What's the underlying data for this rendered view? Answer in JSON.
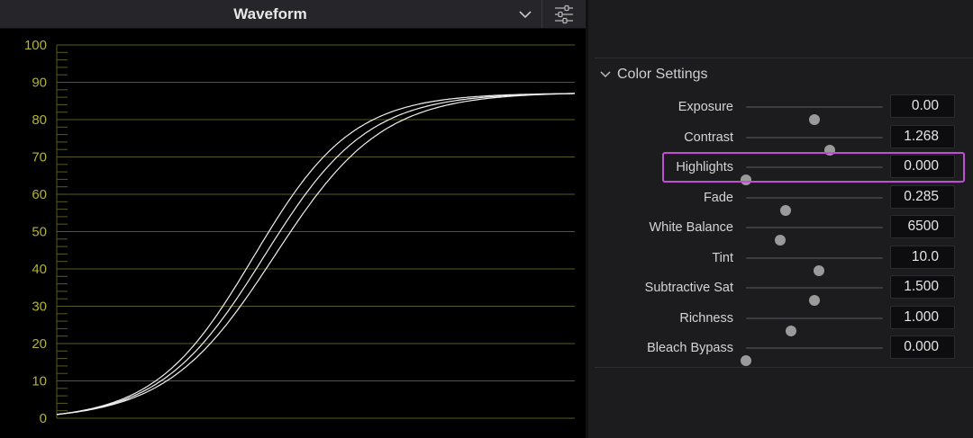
{
  "scope": {
    "title": "Waveform",
    "dropdown_icon": "chevron-down-icon",
    "settings_icon": "sliders-icon",
    "y_ticks": [
      "0",
      "10",
      "20",
      "30",
      "40",
      "50",
      "60",
      "70",
      "80",
      "90",
      "100"
    ],
    "colors": {
      "tick_label": "#b2b234",
      "gridline": "#5a5a20",
      "trace": "#f0f0f0"
    }
  },
  "panel": {
    "section_title": "Color Settings",
    "section_icon": "chevron-down-icon",
    "highlight_color": "#c14fd6",
    "rows": [
      {
        "label": "Exposure",
        "value": "0.00",
        "level": 0.5
      },
      {
        "label": "Contrast",
        "value": "1.268",
        "level": 0.61
      },
      {
        "label": "Highlights",
        "value": "0.000",
        "level": 0.0,
        "highlighted": true
      },
      {
        "label": "Fade",
        "value": "0.285",
        "level": 0.29
      },
      {
        "label": "White Balance",
        "value": "6500",
        "level": 0.25
      },
      {
        "label": "Tint",
        "value": "10.0",
        "level": 0.53
      },
      {
        "label": "Subtractive Sat",
        "value": "1.500",
        "level": 0.5
      },
      {
        "label": "Richness",
        "value": "1.000",
        "level": 0.33
      },
      {
        "label": "Bleach Bypass",
        "value": "0.000",
        "level": 0.0
      }
    ]
  }
}
